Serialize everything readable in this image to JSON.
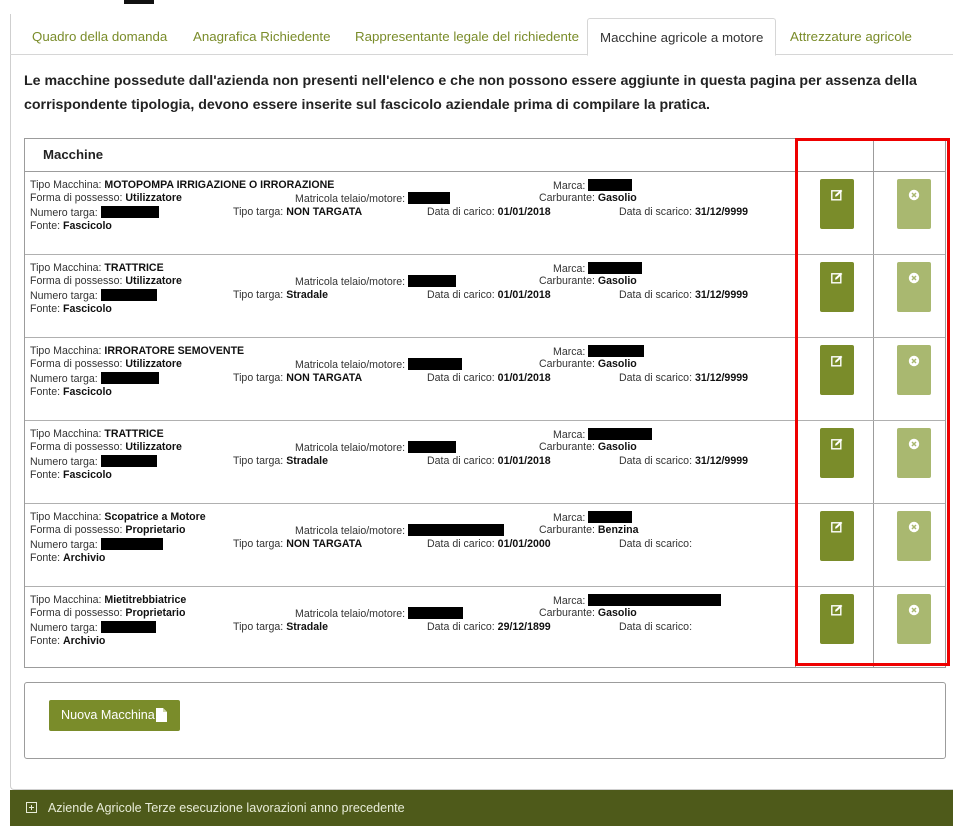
{
  "tabs": [
    {
      "label": "Quadro della domanda",
      "active": false
    },
    {
      "label": "Anagrafica Richiedente",
      "active": false
    },
    {
      "label": "Rappresentante legale del richiedente",
      "active": false
    },
    {
      "label": "Macchine agricole a motore",
      "active": true
    },
    {
      "label": "Attrezzature agricole",
      "active": false
    }
  ],
  "intro": "Le macchine possedute dall'azienda non presenti nell'elenco e che non possono essere aggiunte in questa pagina per assenza della corrispondente tipologia, devono essere inserite sul fascicolo aziendale prima di compilare la pratica.",
  "table": {
    "title": "Macchine",
    "labels": {
      "tipo": "Tipo Macchina:",
      "forma": "Forma di possesso:",
      "numero": "Numero targa:",
      "fonte": "Fonte:",
      "matricola": "Matricola telaio/motore:",
      "tipo_targa": "Tipo targa:",
      "marca": "Marca:",
      "carburante": "Carburante:",
      "carico": "Data di carico:",
      "scarico": "Data di scarico:"
    },
    "rows": [
      {
        "tipo": "MOTOPOMPA IRRIGAZIONE O IRRORAZIONE",
        "forma": "Utilizzatore",
        "tipo_targa": "NON TARGATA",
        "carburante": "Gasolio",
        "carico": "01/01/2018",
        "scarico": "31/12/9999",
        "fonte": "Fascicolo"
      },
      {
        "tipo": "TRATTRICE",
        "forma": "Utilizzatore",
        "tipo_targa": "Stradale",
        "carburante": "Gasolio",
        "carico": "01/01/2018",
        "scarico": "31/12/9999",
        "fonte": "Fascicolo"
      },
      {
        "tipo": "IRRORATORE SEMOVENTE",
        "forma": "Utilizzatore",
        "tipo_targa": "NON TARGATA",
        "carburante": "Gasolio",
        "carico": "01/01/2018",
        "scarico": "31/12/9999",
        "fonte": "Fascicolo"
      },
      {
        "tipo": "TRATTRICE",
        "forma": "Utilizzatore",
        "tipo_targa": "Stradale",
        "carburante": "Gasolio",
        "carico": "01/01/2018",
        "scarico": "31/12/9999",
        "fonte": "Fascicolo"
      },
      {
        "tipo": "Scopatrice a Motore",
        "forma": "Proprietario",
        "tipo_targa": "NON TARGATA",
        "carburante": "Benzina",
        "carico": "01/01/2000",
        "scarico": "",
        "fonte": "Archivio"
      },
      {
        "tipo": "Mietitrebbiatrice",
        "forma": "Proprietario",
        "tipo_targa": "Stradale",
        "carburante": "Gasolio",
        "carico": "29/12/1899",
        "scarico": "",
        "fonte": "Archivio"
      }
    ]
  },
  "new_button": "Nuova Macchina",
  "bottom_bar": "Aziende Agricole Terze esecuzione lavorazioni anno precedente",
  "icons": {
    "edit": "edit-icon",
    "delete": "remove-circle-icon",
    "new": "document-icon",
    "expand": "plus-square-icon"
  },
  "colors": {
    "accent": "#7a8c2a",
    "accent_light": "#a9b870",
    "dark_bar": "#4e5a1a",
    "highlight": "#ee0000"
  }
}
